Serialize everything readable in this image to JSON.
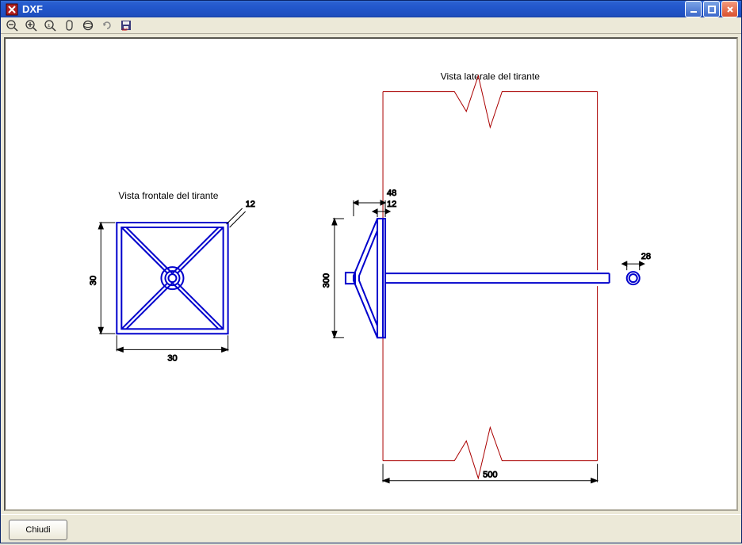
{
  "window": {
    "title": "DXF"
  },
  "toolbar": {
    "icons": [
      "zoom-out",
      "zoom-in",
      "zoom-fit",
      "pan",
      "orbit",
      "refresh",
      "save-dxf"
    ]
  },
  "drawing": {
    "front_view": {
      "title": "Vista frontale del tirante",
      "dim_vertical": "30",
      "dim_horizontal": "30",
      "dim_callout": "12"
    },
    "side_view": {
      "title": "Vista laterale del tirante",
      "dim_vertical": "300",
      "dim_horizontal": "500",
      "dim_top1": "48",
      "dim_top2": "12",
      "dim_ring": "28"
    }
  },
  "footer": {
    "close_label": "Chiudi"
  },
  "chart_data": {
    "type": "table",
    "title": "Tirante dimensions (DXF)",
    "series": [
      {
        "name": "Vista frontale del tirante",
        "values": {
          "width": 30,
          "height": 30,
          "plate_thickness_callout": 12
        }
      },
      {
        "name": "Vista laterale del tirante",
        "values": {
          "plate_height": 300,
          "wall_depth": 500,
          "flange_width": 48,
          "plate_thickness": 12,
          "rod_diameter": 28
        }
      }
    ]
  }
}
